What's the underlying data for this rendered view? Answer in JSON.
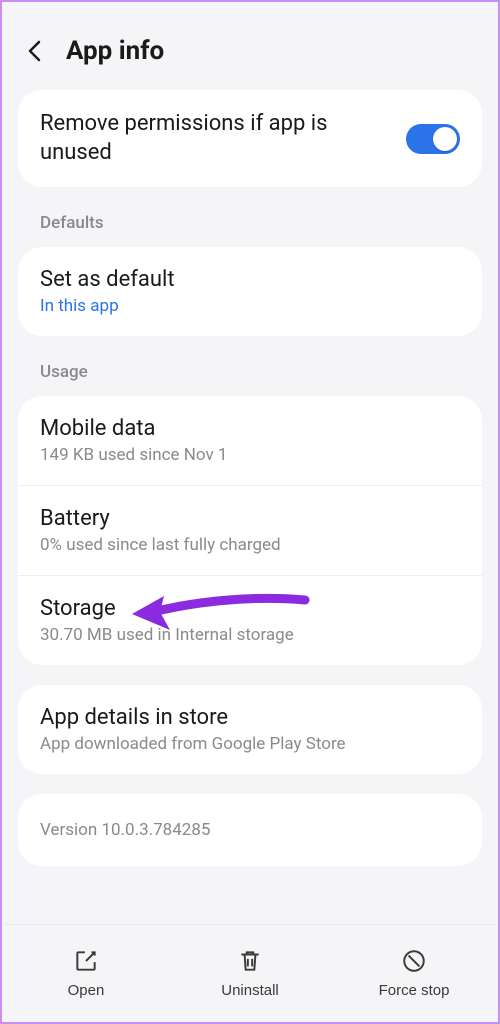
{
  "header": {
    "title": "App info"
  },
  "permissions": {
    "remove_label": "Remove permissions if app is unused",
    "toggle_on": true
  },
  "sections": {
    "defaults_label": "Defaults",
    "usage_label": "Usage"
  },
  "defaults": {
    "set_default_title": "Set as default",
    "set_default_sub": "In this app"
  },
  "usage": {
    "mobile": {
      "title": "Mobile data",
      "sub": "149 KB used since Nov 1"
    },
    "battery": {
      "title": "Battery",
      "sub": "0% used since last fully charged"
    },
    "storage": {
      "title": "Storage",
      "sub": "30.70 MB used in Internal storage"
    }
  },
  "store": {
    "title": "App details in store",
    "sub": "App downloaded from Google Play Store"
  },
  "version": {
    "text": "Version 10.0.3.784285"
  },
  "bottom": {
    "open": "Open",
    "uninstall": "Uninstall",
    "force_stop": "Force stop"
  },
  "annotation": {
    "arrow_color": "#8a2be2"
  }
}
